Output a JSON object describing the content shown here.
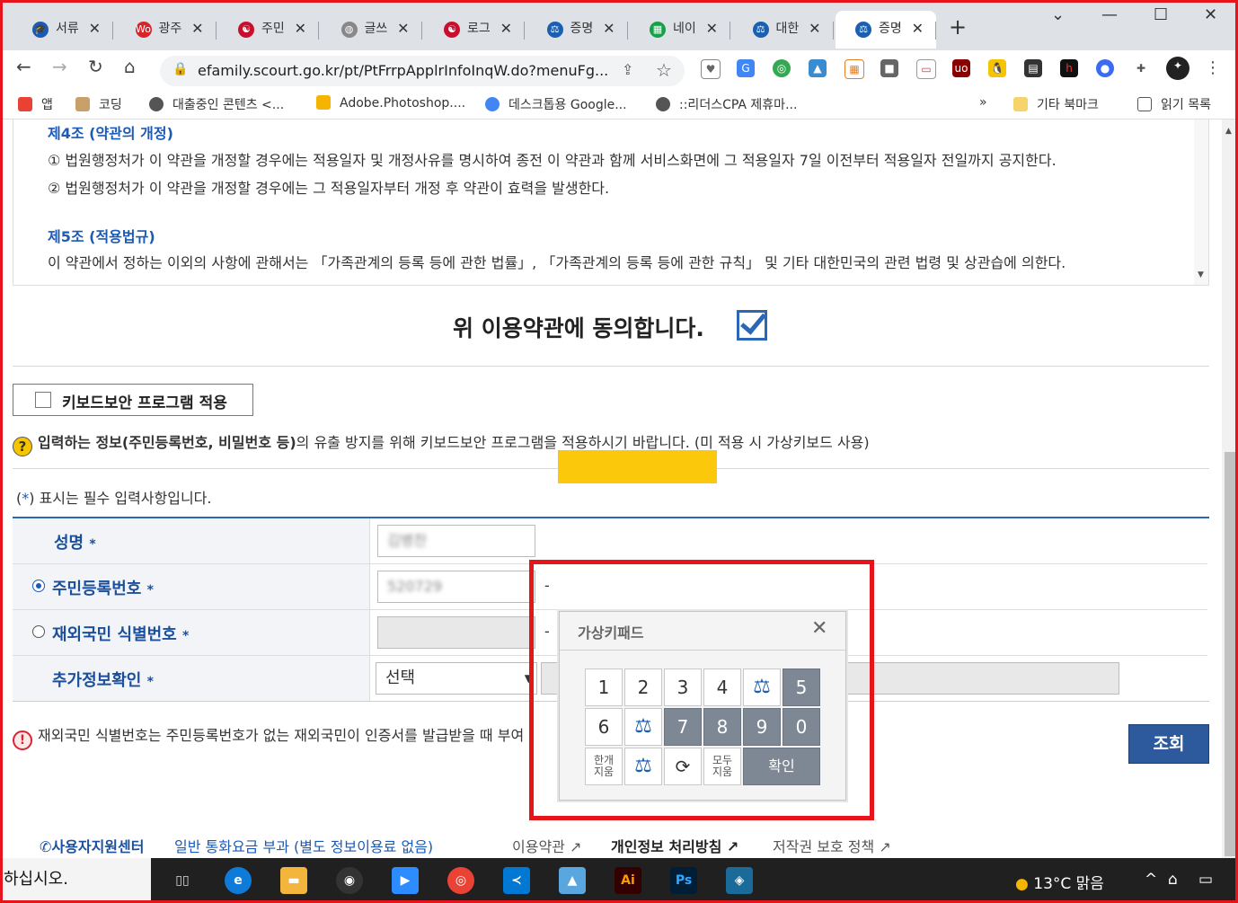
{
  "browser": {
    "tabs": [
      {
        "title": "서류",
        "fav": "gov",
        "color": "#1b5ab5"
      },
      {
        "title": "광주",
        "fav": "wo",
        "color": "#d8232a"
      },
      {
        "title": "주민",
        "fav": "taeguk",
        "color": "#c8102e"
      },
      {
        "title": "글쓰",
        "fav": "blog",
        "color": "#888888"
      },
      {
        "title": "로그",
        "fav": "taeguk",
        "color": "#c8102e"
      },
      {
        "title": "증명",
        "fav": "court",
        "color": "#1a5fb0"
      },
      {
        "title": "네이",
        "fav": "sheet",
        "color": "#18a049"
      },
      {
        "title": "대한",
        "fav": "court",
        "color": "#1a5fb0"
      },
      {
        "title": "증명",
        "fav": "court",
        "color": "#1a5fb0"
      }
    ],
    "close_glyph": "✕",
    "new_tab": "+",
    "url": "efamily.scourt.go.kr/pt/PtFrrpApplrInfoInqW.do?menuFg...",
    "bookmarks": [
      {
        "label": "앱",
        "color": "#e94235"
      },
      {
        "label": "코딩",
        "color": "#c9a06a"
      },
      {
        "label": "대출중인 콘텐츠 <...",
        "color": "#555555"
      },
      {
        "label": "Adobe.Photoshop....",
        "color": "#f4b400"
      },
      {
        "label": "데스크톱용 Google...",
        "color": "#4285f4"
      },
      {
        "label": "::리더스CPA 제휴마...",
        "color": "#555555"
      }
    ],
    "more_bookmarks": "»",
    "other_bookmarks": "기타 북마크",
    "reading_list": "읽기 목록"
  },
  "terms": {
    "article4_title": "제4조 (약관의 개정)",
    "article4_line1": "① 법원행정처가 이 약관을 개정할 경우에는 적용일자 및 개정사유를 명시하여 종전 이 약관과 함께 서비스화면에 그 적용일자 7일 이전부터 적용일자 전일까지 공지한다.",
    "article4_line2": "② 법원행정처가 이 약관을 개정할 경우에는 그 적용일자부터 개정 후 약관이 효력을 발생한다.",
    "article5_title": "제5조 (적용법규)",
    "article5_line1": "이 약관에서 정하는 이외의 사항에 관해서는 「가족관계의 등록 등에 관한 법률」, 「가족관계의 등록 등에 관한 규칙」 및 기타 대한민국의 관련 법령 및 상관습에 의한다."
  },
  "agree": {
    "label": "위 이용약관에 동의합니다.",
    "checked": true
  },
  "keyboard_security": {
    "label": "키보드보안 프로그램 적용",
    "checked": false
  },
  "notice": {
    "bold": "입력하는 정보(주민등록번호, 비밀번호 등)",
    "rest": "의 유출 방지를 위해 키보드보안 프로그램을 적용하시기 바랍니다. (미 적용 시 가상키보드 사용)"
  },
  "required_note": {
    "open": "(",
    "star": "*",
    "text": ") 표시는 필수 입력사항입니다."
  },
  "form": {
    "required_mark": "*",
    "name_label": "성명",
    "name_value": "김병찬",
    "rrn_label": "주민등록번호",
    "rrn_front": "520729",
    "foreign_label": "재외국민 식별번호",
    "extra_label": "추가정보확인",
    "extra_select": "선택",
    "dash": "-"
  },
  "warning": {
    "text": "재외국민 식별번호는 주민등록번호가 없는 재외국민이 인증서를 발급받을 때 부여"
  },
  "search_button": "조회",
  "keypad": {
    "title": "가상키패드",
    "row1": [
      "1",
      "2",
      "3",
      "4",
      "",
      "5"
    ],
    "row2": [
      "6",
      "",
      "7",
      "8",
      "9",
      "0"
    ],
    "backspace": "한개\n지움",
    "clear": "모두\n지움",
    "confirm": "확인"
  },
  "footer": {
    "support": "사용자지원센터",
    "support_note": "일반 통화요금 부과 (별도 정보이용료 없음)",
    "terms_link": "이용약관",
    "privacy_link": "개인정보 처리방침",
    "copyright_link": "저작권 보호 정책"
  },
  "taskbar": {
    "search_text": "하십시오.",
    "weather": "13°C  맑음"
  }
}
